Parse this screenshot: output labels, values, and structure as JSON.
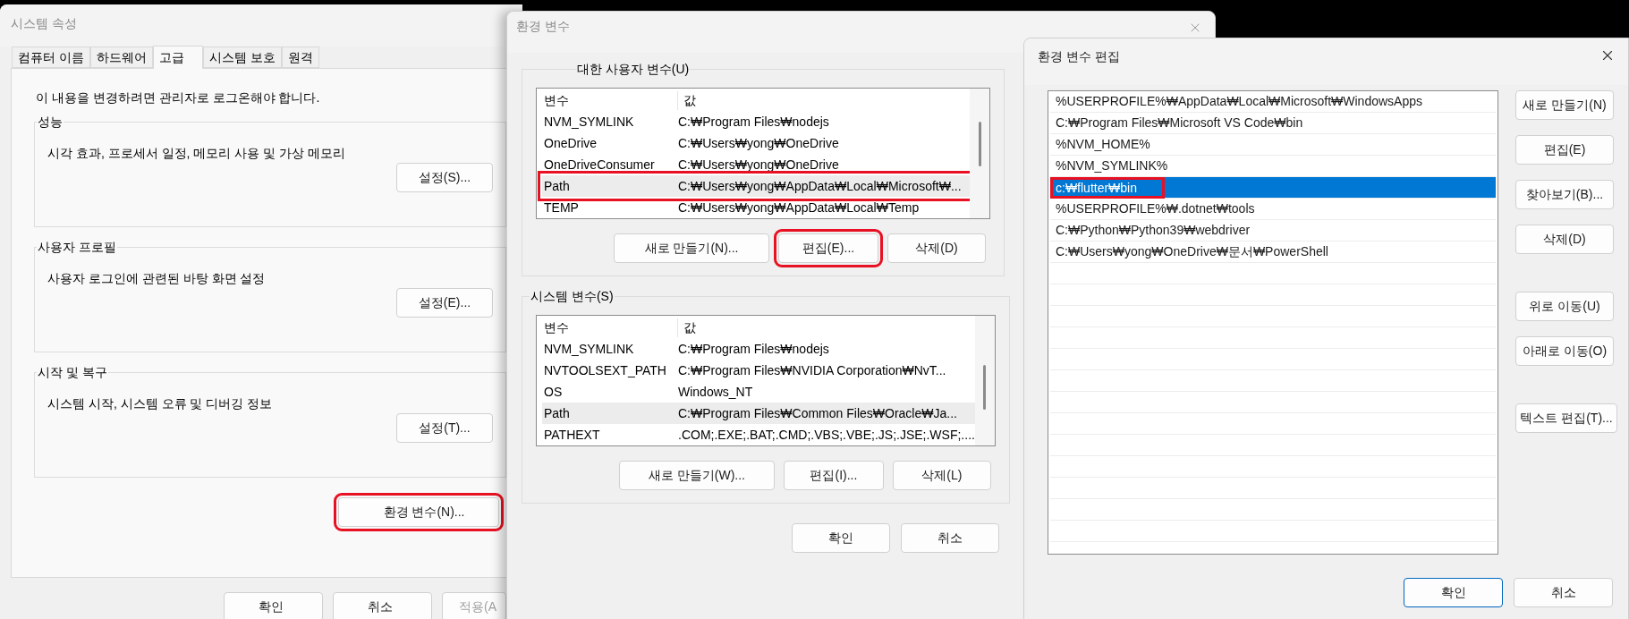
{
  "system_properties": {
    "title": "시스템 속성",
    "tabs": [
      {
        "label": "컴퓨터 이름",
        "selected": false
      },
      {
        "label": "하드웨어",
        "selected": false
      },
      {
        "label": "고급",
        "selected": true
      },
      {
        "label": "시스템 보호",
        "selected": false
      },
      {
        "label": "원격",
        "selected": false
      }
    ],
    "notice": "이 내용을 변경하려면 관리자로 로그온해야 합니다.",
    "groups": [
      {
        "title": "성능",
        "description": "시각 효과, 프로세서 일정, 메모리 사용 및 가상 메모리",
        "button": "설정(S)..."
      },
      {
        "title": "사용자 프로필",
        "description": "사용자 로그인에 관련된 바탕 화면 설정",
        "button": "설정(E)..."
      },
      {
        "title": "시작 및 복구",
        "description": "시스템 시작, 시스템 오류 및 디버깅 정보",
        "button": "설정(T)..."
      }
    ],
    "env_button": {
      "label": "환경 변수(N)...",
      "highlighted": true
    },
    "footer_buttons": [
      {
        "label": "확인",
        "disabled": false
      },
      {
        "label": "취소",
        "disabled": false
      },
      {
        "label": "적용(A",
        "disabled": true
      }
    ]
  },
  "environment_variables": {
    "title": "환경 변수",
    "sections": [
      {
        "title": "대한 사용자 변수(U)",
        "columns": [
          "변수",
          "값"
        ],
        "rows": [
          {
            "name": "NVM_SYMLINK",
            "value": "C:₩Program Files₩nodejs",
            "selected": false,
            "highlighted": false
          },
          {
            "name": "OneDrive",
            "value": "C:₩Users₩yong₩OneDrive",
            "selected": false,
            "highlighted": false
          },
          {
            "name": "OneDriveConsumer",
            "value": "C:₩Users₩yong₩OneDrive",
            "selected": false,
            "highlighted": false
          },
          {
            "name": "Path",
            "value": "C:₩Users₩yong₩AppData₩Local₩Microsoft₩...",
            "selected": true,
            "highlighted": true
          },
          {
            "name": "TEMP",
            "value": "C:₩Users₩yong₩AppData₩Local₩Temp",
            "selected": false,
            "highlighted": false
          }
        ],
        "buttons": [
          {
            "label": "새로 만들기(N)...",
            "highlighted": false
          },
          {
            "label": "편집(E)...",
            "highlighted": true
          },
          {
            "label": "삭제(D)",
            "highlighted": false
          }
        ]
      },
      {
        "title": "시스템 변수(S)",
        "columns": [
          "변수",
          "값"
        ],
        "rows": [
          {
            "name": "NVM_SYMLINK",
            "value": "C:₩Program Files₩nodejs",
            "selected": false,
            "highlighted": false
          },
          {
            "name": "NVTOOLSEXT_PATH",
            "value": "C:₩Program Files₩NVIDIA Corporation₩NvT...",
            "selected": false,
            "highlighted": false
          },
          {
            "name": "OS",
            "value": "Windows_NT",
            "selected": false,
            "highlighted": false
          },
          {
            "name": "Path",
            "value": "C:₩Program Files₩Common Files₩Oracle₩Ja...",
            "selected": true,
            "highlighted": false
          },
          {
            "name": "PATHEXT",
            "value": ".COM;.EXE;.BAT;.CMD;.VBS;.VBE;.JS;.JSE;.WSF;....",
            "selected": false,
            "highlighted": false
          }
        ],
        "buttons": [
          {
            "label": "새로 만들기(W)...",
            "highlighted": false
          },
          {
            "label": "편집(I)...",
            "highlighted": false
          },
          {
            "label": "삭제(L)",
            "highlighted": false
          }
        ]
      }
    ],
    "footer_buttons": [
      "확인",
      "취소"
    ]
  },
  "edit_environment_variable": {
    "title": "환경 변수 편집",
    "entries": [
      {
        "text": "%USERPROFILE%₩AppData₩Local₩Microsoft₩WindowsApps",
        "selected": false,
        "highlighted": false
      },
      {
        "text": "C:₩Program Files₩Microsoft VS Code₩bin",
        "selected": false,
        "highlighted": false
      },
      {
        "text": "%NVM_HOME%",
        "selected": false,
        "highlighted": false
      },
      {
        "text": "%NVM_SYMLINK%",
        "selected": false,
        "highlighted": false
      },
      {
        "text": "c:₩flutter₩bin",
        "selected": true,
        "highlighted": true
      },
      {
        "text": "%USERPROFILE%₩.dotnet₩tools",
        "selected": false,
        "highlighted": false
      },
      {
        "text": "C:₩Python₩Python39₩webdriver",
        "selected": false,
        "highlighted": false
      },
      {
        "text": "C:₩Users₩yong₩OneDrive₩문서₩PowerShell",
        "selected": false,
        "highlighted": false
      }
    ],
    "button_groups": [
      [
        "새로 만들기(N)",
        "편집(E)",
        "찾아보기(B)...",
        "삭제(D)"
      ],
      [
        "위로 이동(U)",
        "아래로 이동(O)"
      ],
      [
        "텍스트 편집(T)..."
      ]
    ],
    "footer_buttons": [
      {
        "label": "확인",
        "default": true
      },
      {
        "label": "취소",
        "default": false
      }
    ]
  }
}
